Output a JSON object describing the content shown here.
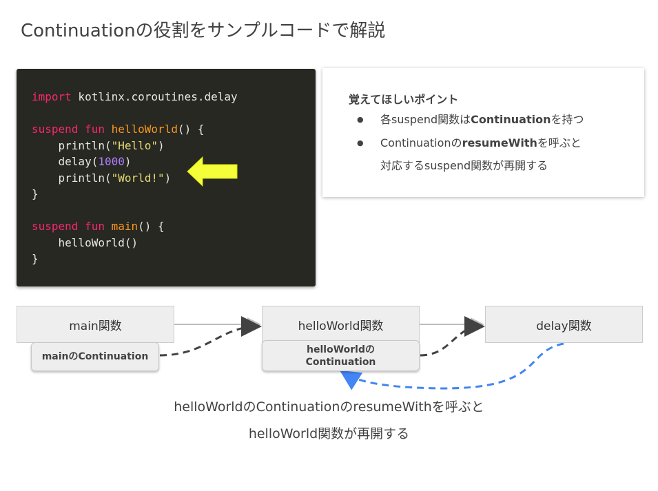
{
  "title": "Continuationの役割をサンプルコードで解説",
  "code": {
    "l1": {
      "kw": "import",
      "rest": " kotlinx.coroutines.delay"
    },
    "l2": {
      "kw1": "suspend",
      "kw2": "fun",
      "fn": "helloWorld",
      "rest": "() {"
    },
    "l3": {
      "pre": "    println(",
      "str": "\"Hello\"",
      "post": ")"
    },
    "l4": {
      "pre": "    delay(",
      "num": "1000",
      "post": ")"
    },
    "l5": {
      "pre": "    println(",
      "str": "\"World!\"",
      "post": ")"
    },
    "l6": "}",
    "l7": {
      "kw1": "suspend",
      "kw2": "fun",
      "fn": "main",
      "rest": "() {"
    },
    "l8": "    helloWorld()",
    "l9": "}",
    "arrow_color": "#f4ff3a"
  },
  "points": {
    "title": "覚えてほしいポイント",
    "bullet": "●",
    "p1": {
      "a": "各suspend関数は",
      "b": "Continuation",
      "c": "を持つ"
    },
    "p2": {
      "a": "Continuationの",
      "b": "resumeWith",
      "c": "を呼ぶと"
    },
    "p2_cont": "対応するsuspend関数が再開する"
  },
  "diagram": {
    "main_box": "main関数",
    "hello_box": "helloWorld関数",
    "delay_box": "delay関数",
    "main_cont": "mainのContinuation",
    "hello_cont_1": "helloWorldの",
    "hello_cont_2": "Continuation",
    "caption_1": "helloWorldのContinuationのresumeWithを呼ぶと",
    "caption_2": "helloWorld関数が再開する",
    "resume_arrow_color": "#4285f4"
  }
}
